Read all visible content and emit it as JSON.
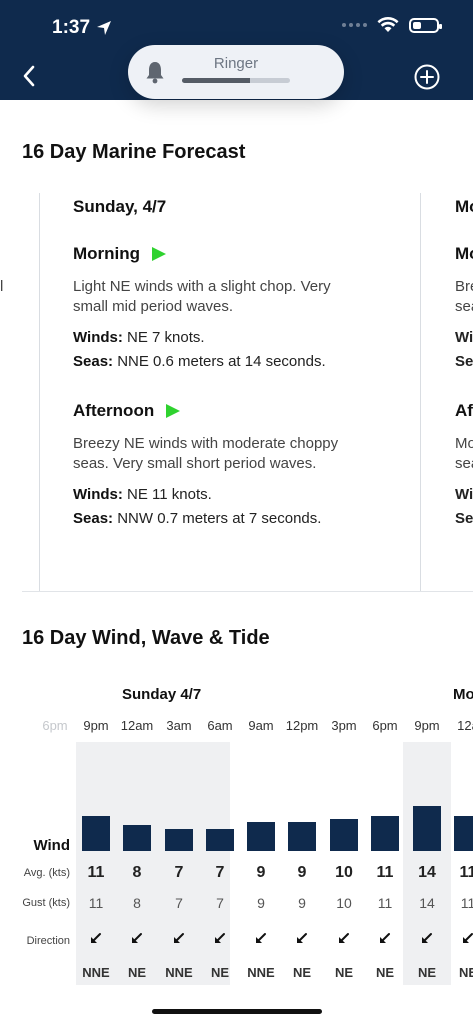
{
  "status_bar": {
    "time": "1:37"
  },
  "ringer": {
    "label": "Ringer",
    "level_fraction": 0.63
  },
  "marine": {
    "title": "16 Day Marine Forecast",
    "left_clip_text": "l",
    "day1": {
      "title": "Sunday, 4/7",
      "morning": {
        "title": "Morning",
        "desc1": "Light NE winds with a slight chop. Very",
        "desc2": "small mid period waves.",
        "winds_label": "Winds:",
        "winds_value": " NE 7 knots.",
        "seas_label": "Seas:",
        "seas_value": " NNE 0.6 meters at 14 seconds."
      },
      "afternoon": {
        "title": "Afternoon",
        "desc1": "Breezy NE winds with moderate choppy",
        "desc2": "seas. Very small short period waves.",
        "winds_label": "Winds:",
        "winds_value": " NE 11 knots.",
        "seas_label": "Seas:",
        "seas_value": " NNW 0.7 meters at 7 seconds."
      }
    },
    "day2_clipped": {
      "title": "Mo",
      "morning": "Mo",
      "desc1": "Bre",
      "desc2": "sea",
      "winds": "Wi",
      "seas": "Se",
      "afternoon": "Af",
      "adesc1": "Mo",
      "adesc2": "sea",
      "awinds": "Wi",
      "aseas": "Se"
    }
  },
  "wind": {
    "title": "16 Day Wind, Wave & Tide",
    "day_label": "Sunday 4/7",
    "next_day_clip": "Mo",
    "times": [
      "6pm",
      "9pm",
      "12am",
      "3am",
      "6am",
      "9am",
      "12pm",
      "3pm",
      "6pm",
      "9pm",
      "12a"
    ],
    "labels": {
      "wind": "Wind",
      "avg": "Avg. (kts)",
      "gust": "Gust (kts)",
      "direction": "Direction"
    },
    "avg": [
      "11",
      "8",
      "7",
      "7",
      "9",
      "9",
      "10",
      "11",
      "14",
      "11"
    ],
    "gust": [
      "11",
      "8",
      "7",
      "7",
      "9",
      "9",
      "10",
      "11",
      "14",
      "11"
    ],
    "dir": [
      "NNE",
      "NE",
      "NNE",
      "NE",
      "NNE",
      "NE",
      "NE",
      "NE",
      "NE",
      "NE"
    ]
  },
  "chart_data": {
    "type": "bar",
    "categories": [
      "9pm",
      "12am",
      "3am",
      "6am",
      "9am",
      "12pm",
      "3pm",
      "6pm",
      "9pm",
      "12a"
    ],
    "series": [
      {
        "name": "Avg. (kts)",
        "values": [
          11,
          8,
          7,
          7,
          9,
          9,
          10,
          11,
          14,
          11
        ]
      }
    ]
  }
}
